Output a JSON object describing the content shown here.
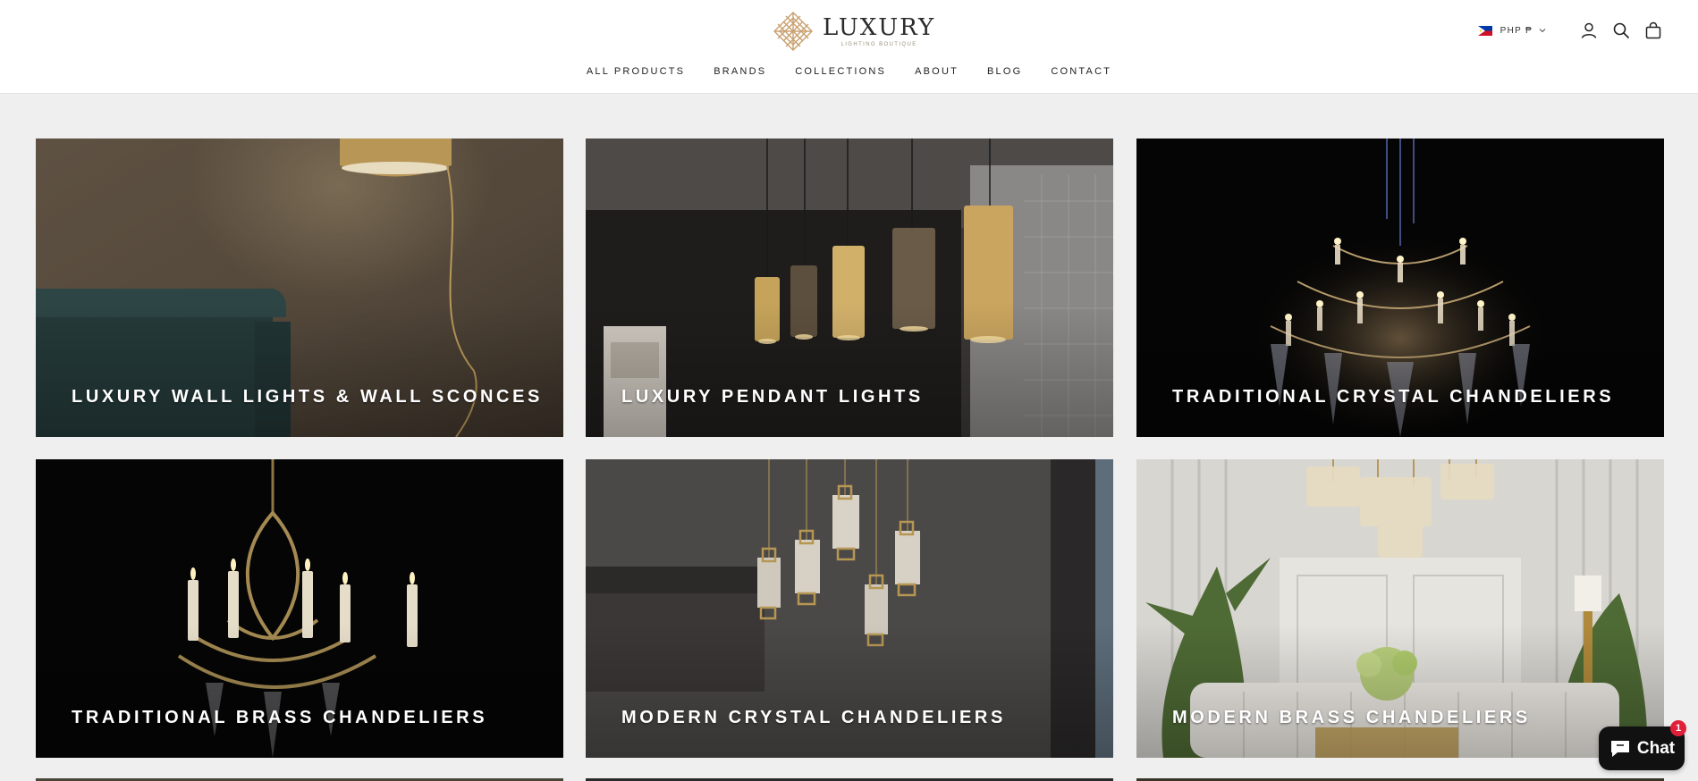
{
  "header": {
    "brand": "LUXURY",
    "brand_sub": "LIGHTING BOUTIQUE",
    "currency": "PHP ₱",
    "nav": [
      "ALL PRODUCTS",
      "BRANDS",
      "COLLECTIONS",
      "ABOUT",
      "BLOG",
      "CONTACT"
    ],
    "icons": [
      "account-icon",
      "search-icon",
      "cart-icon"
    ]
  },
  "collections": [
    {
      "label": "LUXURY WALL LIGHTS & WALL SCONCES"
    },
    {
      "label": "LUXURY PENDANT LIGHTS"
    },
    {
      "label": "TRADITIONAL CRYSTAL CHANDELIERS"
    },
    {
      "label": "TRADITIONAL BRASS CHANDELIERS"
    },
    {
      "label": "MODERN CRYSTAL CHANDELIERS"
    },
    {
      "label": "MODERN BRASS CHANDELIERS"
    }
  ],
  "chat": {
    "label": "Chat",
    "badge": "1"
  },
  "colors": {
    "background": "#efefef",
    "header": "#ffffff",
    "gold": "#c9a866",
    "chat": "#111111",
    "badge": "#e0203a"
  }
}
